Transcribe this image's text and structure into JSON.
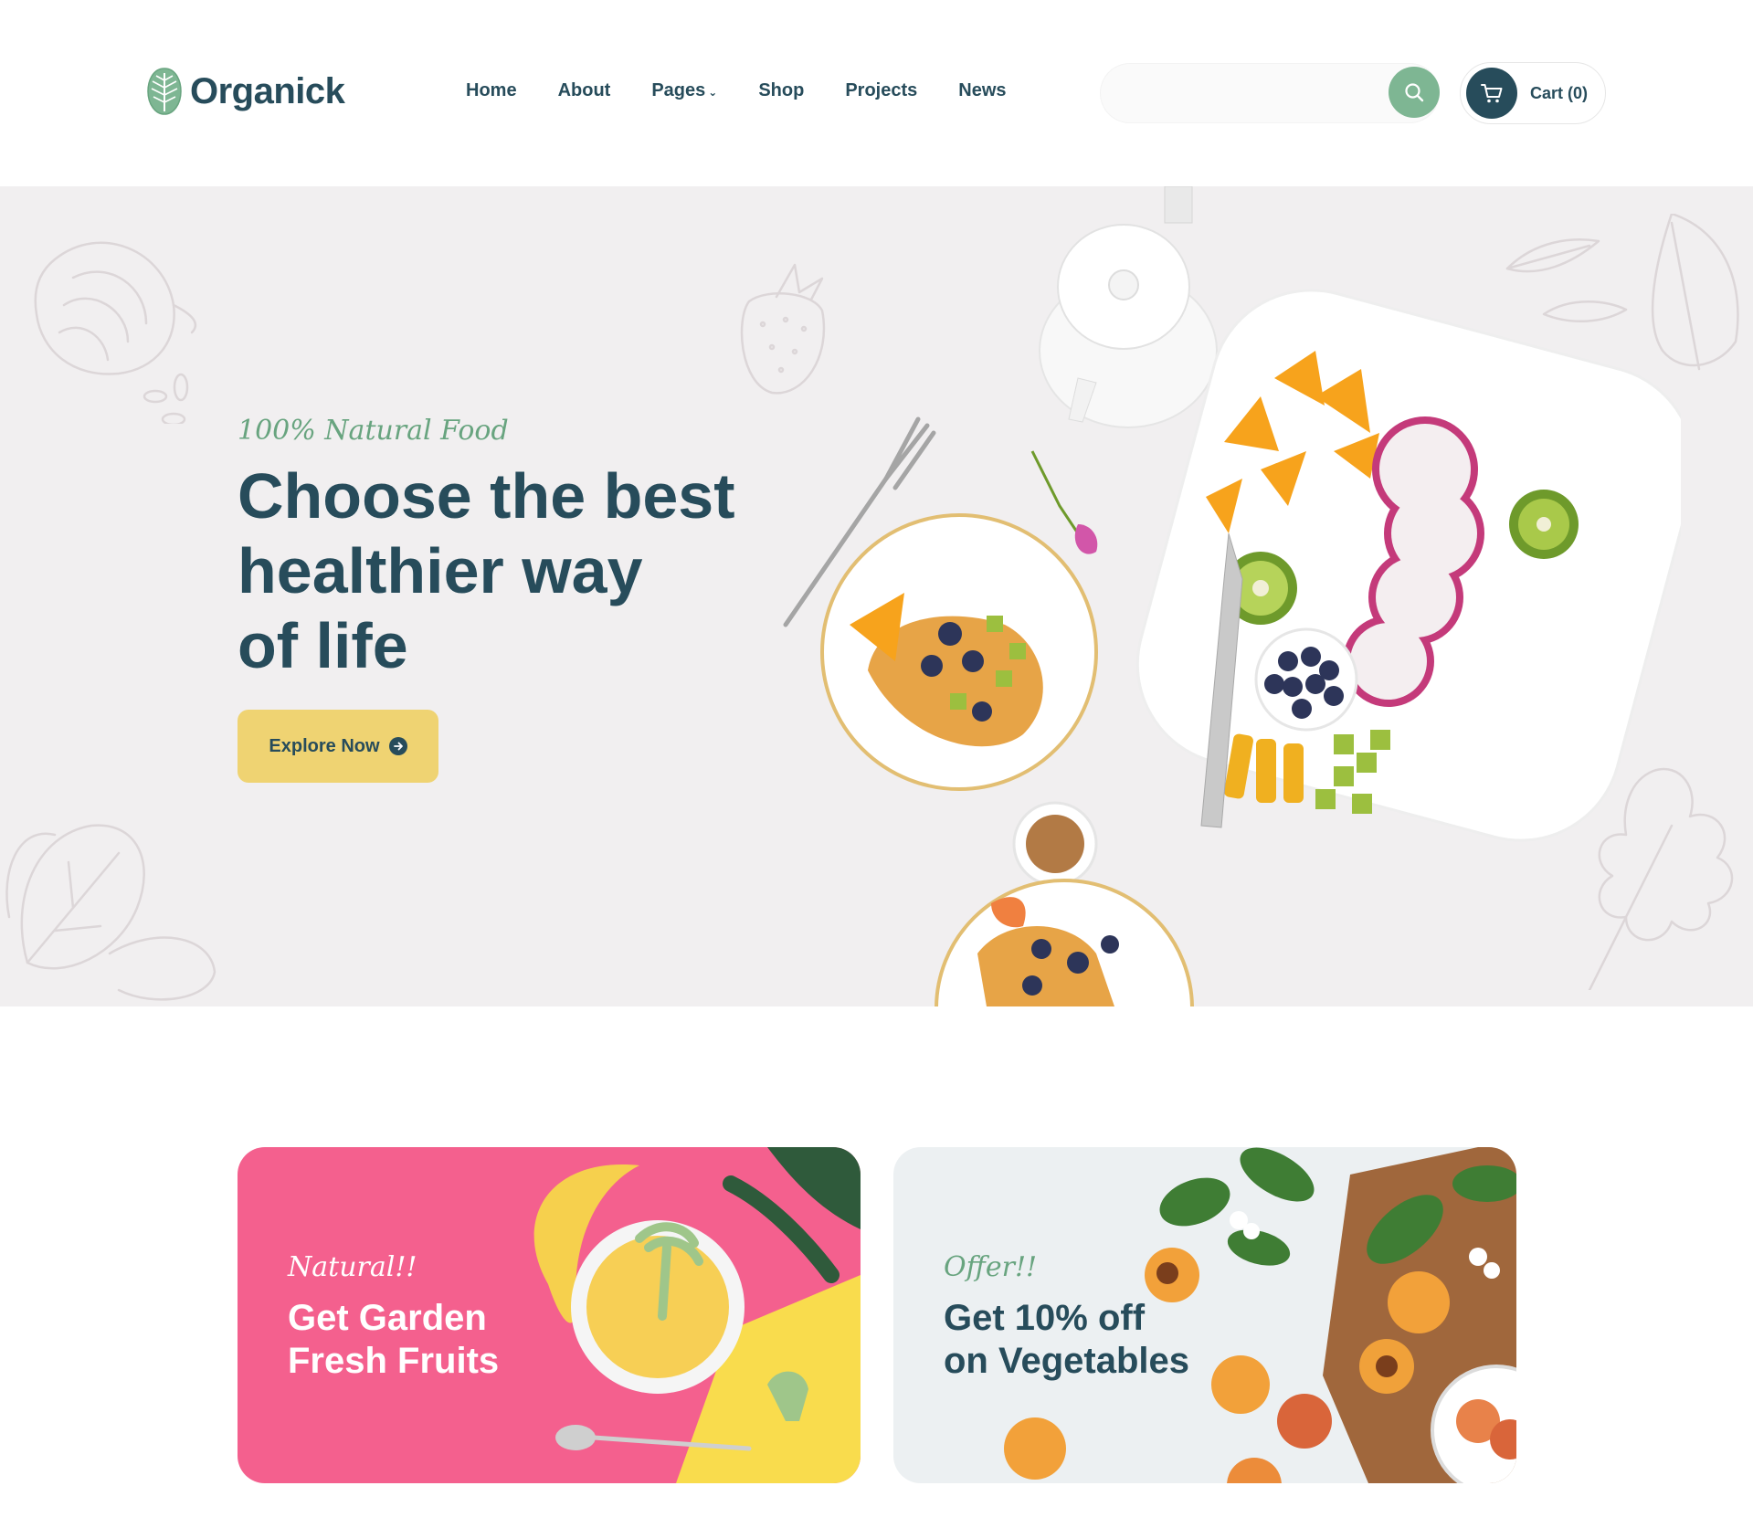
{
  "brand": {
    "name": "Organick",
    "logo_icon": "leaf-logo-icon"
  },
  "nav": {
    "items": [
      {
        "label": "Home"
      },
      {
        "label": "About"
      },
      {
        "label": "Pages",
        "has_dropdown": true
      },
      {
        "label": "Shop"
      },
      {
        "label": "Projects"
      },
      {
        "label": "News"
      }
    ]
  },
  "search": {
    "placeholder": "",
    "button_icon": "search-icon"
  },
  "cart": {
    "label": "Cart (0)",
    "icon": "cart-icon"
  },
  "hero": {
    "subtitle": "100% Natural Food",
    "title_lines": [
      "Choose the best",
      "healthier way",
      "of life"
    ],
    "cta_label": "Explore Now"
  },
  "banners": [
    {
      "subtitle": "Natural!!",
      "title_lines": [
        "Get Garden",
        "Fresh Fruits"
      ]
    },
    {
      "subtitle": "Offer!!",
      "title_lines": [
        "Get 10% off",
        "on Vegetables"
      ]
    }
  ],
  "colors": {
    "primary": "#274c5b",
    "accent_green": "#7eb693",
    "accent_yellow": "#efd372",
    "banner_pink": "#f4608e",
    "hero_bg": "#f1eff0"
  }
}
